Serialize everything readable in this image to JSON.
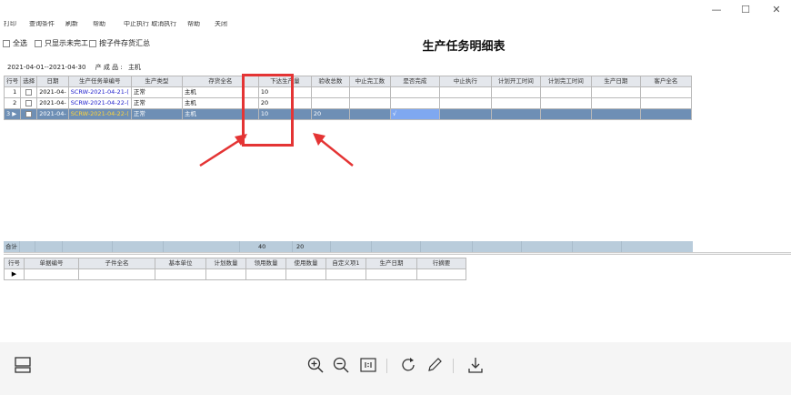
{
  "window": {
    "minimize_glyph": "—",
    "maximize_glyph": "☐",
    "close_glyph": "✕"
  },
  "menubar": {
    "items": [
      "打印",
      "查询条件",
      "刷新",
      "帮助",
      "中止执行 取消执行",
      "帮助",
      "关闭"
    ]
  },
  "options": {
    "select_all": "全选",
    "only_unfinished": "只显示未完工",
    "aggregate_by_child": "按子件存货汇总"
  },
  "report_title": "生产任务明细表",
  "date_range": "2021-04-01--2021-04-30",
  "product_filter_label": "产 成 品 :",
  "product_filter_value": "主机",
  "grid": {
    "columns": [
      "行号",
      "选择",
      "日期",
      "生产任务单编号",
      "生产类型",
      "存货全名",
      "下达生产量",
      "验收总数",
      "中止完工数",
      "是否完成",
      "中止执行",
      "计划开工时间",
      "计划完工时间",
      "生产日期",
      "客户全名"
    ],
    "rows": [
      {
        "no": "1",
        "date": "2021-04-",
        "code": "SCRW-2021-04-21-(",
        "type": "正常",
        "name": "主机",
        "qty": "10",
        "accepted": "",
        "done": ""
      },
      {
        "no": "2",
        "date": "2021-04-",
        "code": "SCRW-2021-04-22-(",
        "type": "正常",
        "name": "主机",
        "qty": "20",
        "accepted": "",
        "done": ""
      },
      {
        "no": "3",
        "date": "2021-04-",
        "code": "SCRW-2021-04-22-(",
        "type": "正常",
        "name": "主机",
        "qty": "10",
        "accepted": "20",
        "done": "√"
      }
    ],
    "totals": {
      "label": "合计",
      "qty": "40",
      "accepted": "20"
    }
  },
  "subgrid": {
    "columns": [
      "行号",
      "单据编号",
      "子件全名",
      "基本单位",
      "计划数量",
      "领用数量",
      "使用数量",
      "自定义项1",
      "生产日期",
      "行摘要"
    ]
  },
  "highlight_color": "#e43434",
  "selected_row_color": "#6e8fb5"
}
